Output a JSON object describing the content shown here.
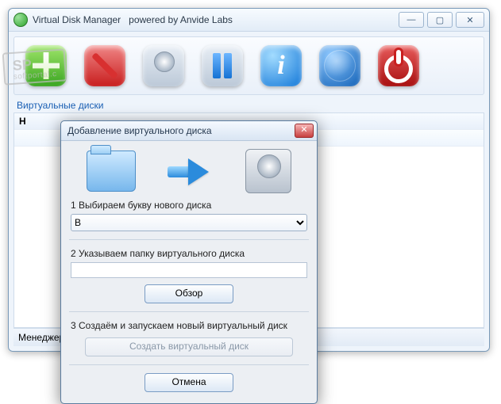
{
  "window": {
    "title": "Virtual Disk Manager   powered by Anvide Labs",
    "min": "—",
    "max": "▢",
    "close": "✕"
  },
  "toolbar": {
    "add": "+",
    "info_glyph": "i"
  },
  "section_label": "Виртуальные диски",
  "list": {
    "header": "H"
  },
  "statusbar": "Менеджер",
  "dialog": {
    "title": "Добавление виртуального диска",
    "close": "✕",
    "step1_label": "1 Выбираем букву нового диска",
    "drive_options": [
      "B"
    ],
    "drive_selected": "B",
    "step2_label": "2 Указываем папку виртуального диска",
    "folder_value": "",
    "browse": "Обзор",
    "step3_label": "3 Создаём и запускаем новый виртуальный диск",
    "create": "Создать виртуальный диск",
    "cancel": "Отмена"
  },
  "watermark": {
    "big": "SP",
    "small": "softportal.c"
  }
}
